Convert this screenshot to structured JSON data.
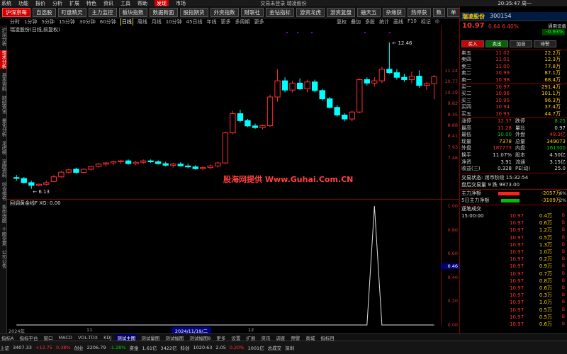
{
  "menu": {
    "items": [
      "系统",
      "功能",
      "报价",
      "分析",
      "扩展",
      "特色",
      "资讯",
      "工具",
      "帮助"
    ],
    "highlight": "发现",
    "highlight2": "市场",
    "title": "交易未登录   瑞凌股份",
    "time": "20:35:47",
    "week": "周一"
  },
  "toolbar": [
    "沪深京每",
    "自选股",
    "盯盘精灵",
    "主力监控",
    "板块指数",
    "数据新面",
    "股指期货",
    "外资指数",
    "财联社",
    "金钻指标",
    "游资龙虎",
    "游资复盘",
    "融天五",
    "杂缘获",
    "热停获",
    "数",
    "单",
    "全数单",
    "今号登录",
    "酷码杭",
    "数精"
  ],
  "toolbar_hl": [
    0
  ],
  "periods": [
    "分时",
    "1分钟",
    "5分钟",
    "15分钟",
    "30分钟",
    "60分钟",
    "日线",
    "周线",
    "月线",
    "10分钟",
    "45日线",
    "年线",
    "更多",
    "多周期",
    "更多"
  ],
  "period_active": "日线",
  "period_right": [
    "复权",
    "叠加",
    "多股",
    "统计",
    "画线",
    "F10",
    "标记",
    "◎"
  ],
  "sidebar": [
    "沪深分析",
    "技术分析",
    "基本资料",
    "财经资讯",
    "量化分析",
    "龙虎榜",
    "深度资料",
    "综合排名",
    "条件选股",
    "个股全景",
    "公司公告"
  ],
  "chart": {
    "title": "瑞凌股份(日线,前复权)",
    "price_labels": [
      "11.24",
      "10.77",
      "10.29",
      "9.82",
      "9.35",
      "8.88",
      "8.41",
      "7.93",
      "7.46"
    ],
    "high_mark": "12.46",
    "low_mark": "6.13"
  },
  "watermark": "股海网提供 Www.Guhai.Com.CN",
  "indicator": {
    "label": "回调黄金线F  XG: 0.00",
    "axis": [
      "1.00",
      "0.80",
      "0.60",
      "0.40",
      "0.20",
      "0.00"
    ],
    "current": "0.46"
  },
  "timebar": {
    "left": "2024年",
    "mark": "11",
    "highlight": "2024/11/19/二",
    "right": "12"
  },
  "bottomtabs": [
    "指标A",
    "指标平台",
    "窗口",
    "MACD",
    "VOL-TDX",
    "KDJ",
    "测试主图",
    "测试量图",
    "测试幅图",
    "测试幅图8",
    "更多",
    "设置",
    "扩展",
    "资讯",
    "调查",
    "预警",
    "商城",
    "指标目"
  ],
  "status": [
    "上证",
    "3407.33",
    "+12.75",
    "0.38%",
    "创业",
    "2206.79",
    "-1.28%",
    "资金",
    "1.61亿",
    "3422亿",
    "科创",
    "1020.63",
    "2.05",
    "0.20%",
    "1001亿",
    "总成交",
    "深圳"
  ],
  "right": {
    "name": "瑞凌股份",
    "code": "300154",
    "price": "10.97",
    "change": "0.64",
    "change_pct": "6.40%",
    "subtitle": "通用设备",
    "sub_value": "-0.93%",
    "buttons": [
      "买入",
      "卖出",
      "加自",
      "待警"
    ],
    "asks": [
      {
        "l": "卖五",
        "p": "11.02",
        "v": "22.2万"
      },
      {
        "l": "卖四",
        "p": "11.01",
        "v": "12.3万"
      },
      {
        "l": "卖三",
        "p": "11.00",
        "v": "77.8万"
      },
      {
        "l": "卖二",
        "p": "10.99",
        "v": "87.1万"
      },
      {
        "l": "卖一",
        "p": "10.98",
        "v": "68.4万"
      }
    ],
    "bids": [
      {
        "l": "买一",
        "p": "10.97",
        "v": "291.4万"
      },
      {
        "l": "买二",
        "p": "10.96",
        "v": "101.1万"
      },
      {
        "l": "买三",
        "p": "10.95",
        "v": "96.3万"
      },
      {
        "l": "买四",
        "p": "10.94",
        "v": "37.4万"
      },
      {
        "l": "买五",
        "p": "10.93",
        "v": "44.7万"
      }
    ],
    "stats": [
      [
        {
          "l": "涨停",
          "v": "12.37",
          "c": "red"
        },
        {
          "l": "跌停",
          "v": "8.25",
          "c": "grn"
        }
      ],
      [
        {
          "l": "最高",
          "v": "11.28",
          "c": "red"
        },
        {
          "l": "量比",
          "v": "0.97",
          "c": "wht"
        }
      ],
      [
        {
          "l": "最低",
          "v": "10.00",
          "c": "grn"
        },
        {
          "l": "外盘",
          "v": "49.3亿",
          "c": "red"
        }
      ],
      [
        {
          "l": "现量",
          "v": "7378",
          "c": "yel"
        },
        {
          "l": "总量",
          "v": "349073",
          "c": "yel"
        }
      ],
      [
        {
          "l": "外盘",
          "v": "187773",
          "c": "red"
        },
        {
          "l": "内盘",
          "v": "161300",
          "c": "grn"
        }
      ],
      [
        {
          "l": "换手",
          "v": "11.07%",
          "c": "wht"
        },
        {
          "l": "股本",
          "v": "4.50亿",
          "c": "wht"
        }
      ],
      [
        {
          "l": "净资",
          "v": "3.91",
          "c": "wht"
        },
        {
          "l": "流通",
          "v": "3.15亿",
          "c": "wht"
        }
      ],
      [
        {
          "l": "收益(三)",
          "v": "0.328",
          "c": "wht"
        },
        {
          "l": "PE(动)",
          "v": "25.0",
          "c": "wht"
        }
      ]
    ],
    "trade_state": "交易状态: 闭市阶段 15:32:54",
    "auction": "盘后交易量 9 跌 9873.00",
    "main_flow": {
      "l": "主力净额",
      "v": "-2057万",
      "pct": "6%"
    },
    "flow5": {
      "l": "5日主力净额",
      "v": "-3109万",
      "pct": "2%"
    },
    "ticks_title": "逐笔成交",
    "ticks": [
      {
        "t": "15:00:00",
        "p": "10.97",
        "v": "0.4万"
      },
      {
        "t": "",
        "p": "10.97",
        "v": "0.6万"
      },
      {
        "t": "",
        "p": "10.97",
        "v": "1.2万"
      },
      {
        "t": "",
        "p": "10.97",
        "v": "0.5万"
      },
      {
        "t": "",
        "p": "10.97",
        "v": "1.3万"
      },
      {
        "t": "",
        "p": "10.97",
        "v": "1.0万"
      },
      {
        "t": "",
        "p": "10.97",
        "v": "0.2万"
      },
      {
        "t": "",
        "p": "10.97",
        "v": "0.9万"
      },
      {
        "t": "",
        "p": "10.97",
        "v": "0.7万"
      },
      {
        "t": "",
        "p": "10.97",
        "v": "0.8万"
      },
      {
        "t": "",
        "p": "10.97",
        "v": "0.6万"
      },
      {
        "t": "",
        "p": "10.97",
        "v": "0.3万"
      },
      {
        "t": "",
        "p": "10.97",
        "v": "1.0万"
      },
      {
        "t": "",
        "p": "10.97",
        "v": "0.5万"
      },
      {
        "t": "",
        "p": "10.97",
        "v": "0.5万"
      },
      {
        "t": "",
        "p": "10.97",
        "v": "0.6万"
      }
    ]
  },
  "colors": {
    "up": "#ff3030",
    "down": "#00ffff",
    "grid": "#8a0000",
    "bg": "#000000"
  },
  "chart_data": {
    "type": "candlestick",
    "candles": [
      {
        "o": 6.62,
        "h": 6.73,
        "l": 6.48,
        "c": 6.58
      },
      {
        "o": 6.58,
        "h": 6.64,
        "l": 6.36,
        "c": 6.4
      },
      {
        "o": 6.4,
        "h": 6.48,
        "l": 6.13,
        "c": 6.28
      },
      {
        "o": 6.28,
        "h": 6.35,
        "l": 6.24,
        "c": 6.33
      },
      {
        "o": 6.33,
        "h": 6.48,
        "l": 6.28,
        "c": 6.4
      },
      {
        "o": 6.45,
        "h": 6.72,
        "l": 6.42,
        "c": 6.65
      },
      {
        "o": 6.65,
        "h": 6.9,
        "l": 6.6,
        "c": 6.85
      },
      {
        "o": 6.85,
        "h": 7.0,
        "l": 6.78,
        "c": 6.95
      },
      {
        "o": 6.98,
        "h": 7.05,
        "l": 6.8,
        "c": 6.84
      },
      {
        "o": 6.84,
        "h": 7.0,
        "l": 6.8,
        "c": 6.98
      },
      {
        "o": 6.98,
        "h": 7.12,
        "l": 6.92,
        "c": 7.1
      },
      {
        "o": 7.1,
        "h": 7.25,
        "l": 7.05,
        "c": 7.2
      },
      {
        "o": 7.2,
        "h": 7.3,
        "l": 7.1,
        "c": 7.25
      },
      {
        "o": 7.25,
        "h": 7.35,
        "l": 7.15,
        "c": 7.3
      },
      {
        "o": 7.3,
        "h": 7.38,
        "l": 7.2,
        "c": 7.34
      },
      {
        "o": 7.34,
        "h": 7.4,
        "l": 7.18,
        "c": 7.22
      },
      {
        "o": 7.22,
        "h": 7.33,
        "l": 7.15,
        "c": 7.28
      },
      {
        "o": 7.28,
        "h": 7.4,
        "l": 7.2,
        "c": 7.34
      },
      {
        "o": 7.34,
        "h": 7.4,
        "l": 7.25,
        "c": 7.3
      },
      {
        "o": 7.3,
        "h": 7.36,
        "l": 7.18,
        "c": 7.22
      },
      {
        "o": 7.22,
        "h": 7.3,
        "l": 7.1,
        "c": 7.15
      },
      {
        "o": 7.15,
        "h": 7.26,
        "l": 7.05,
        "c": 7.2
      },
      {
        "o": 7.2,
        "h": 7.28,
        "l": 7.1,
        "c": 7.12
      },
      {
        "o": 7.12,
        "h": 7.22,
        "l": 7.02,
        "c": 7.08
      },
      {
        "o": 7.08,
        "h": 7.15,
        "l": 6.96,
        "c": 7.0
      },
      {
        "o": 7.0,
        "h": 7.1,
        "l": 6.92,
        "c": 7.05
      },
      {
        "o": 7.05,
        "h": 7.18,
        "l": 6.98,
        "c": 7.12
      },
      {
        "o": 7.12,
        "h": 7.3,
        "l": 7.05,
        "c": 7.25
      },
      {
        "o": 7.25,
        "h": 8.6,
        "l": 7.2,
        "c": 8.55
      },
      {
        "o": 8.55,
        "h": 9.5,
        "l": 8.5,
        "c": 9.38
      },
      {
        "o": 9.38,
        "h": 9.55,
        "l": 9.0,
        "c": 9.08
      },
      {
        "o": 9.08,
        "h": 9.15,
        "l": 8.8,
        "c": 8.85
      },
      {
        "o": 8.85,
        "h": 8.95,
        "l": 8.72,
        "c": 8.78
      },
      {
        "o": 8.78,
        "h": 8.9,
        "l": 8.7,
        "c": 8.86
      },
      {
        "o": 8.86,
        "h": 10.2,
        "l": 8.8,
        "c": 10.1
      },
      {
        "o": 10.1,
        "h": 11.3,
        "l": 9.9,
        "c": 10.8
      },
      {
        "o": 10.8,
        "h": 10.95,
        "l": 10.3,
        "c": 10.4
      },
      {
        "o": 10.4,
        "h": 10.8,
        "l": 10.3,
        "c": 10.7
      },
      {
        "o": 10.7,
        "h": 10.9,
        "l": 10.4,
        "c": 10.45
      },
      {
        "o": 10.45,
        "h": 10.85,
        "l": 10.3,
        "c": 10.75
      },
      {
        "o": 10.75,
        "h": 10.85,
        "l": 10.3,
        "c": 10.38
      },
      {
        "o": 10.38,
        "h": 10.45,
        "l": 9.95,
        "c": 10.02
      },
      {
        "o": 10.02,
        "h": 10.1,
        "l": 9.6,
        "c": 9.65
      },
      {
        "o": 9.65,
        "h": 9.75,
        "l": 9.25,
        "c": 9.32
      },
      {
        "o": 9.32,
        "h": 9.4,
        "l": 9.05,
        "c": 9.15
      },
      {
        "o": 9.15,
        "h": 9.5,
        "l": 9.05,
        "c": 9.45
      },
      {
        "o": 9.45,
        "h": 10.9,
        "l": 9.4,
        "c": 10.85
      },
      {
        "o": 10.85,
        "h": 10.95,
        "l": 10.6,
        "c": 10.7
      },
      {
        "o": 10.7,
        "h": 10.95,
        "l": 10.55,
        "c": 10.8
      },
      {
        "o": 10.8,
        "h": 11.4,
        "l": 10.7,
        "c": 11.3
      },
      {
        "o": 11.3,
        "h": 12.46,
        "l": 11.1,
        "c": 11.15
      },
      {
        "o": 11.15,
        "h": 11.3,
        "l": 10.85,
        "c": 10.95
      },
      {
        "o": 10.95,
        "h": 11.1,
        "l": 10.75,
        "c": 10.85
      },
      {
        "o": 10.85,
        "h": 11.2,
        "l": 10.7,
        "c": 11.0
      },
      {
        "o": 11.0,
        "h": 11.25,
        "l": 10.5,
        "c": 10.6
      },
      {
        "o": 10.6,
        "h": 10.75,
        "l": 10.4,
        "c": 10.68
      },
      {
        "o": 10.68,
        "h": 11.05,
        "l": 10.0,
        "c": 10.97
      }
    ],
    "ylim": [
      6.0,
      12.7
    ],
    "indicator": {
      "name": "XG",
      "values": [
        0,
        0,
        0,
        0,
        0,
        0,
        0,
        0,
        0,
        0,
        0,
        0,
        0,
        0,
        0,
        0,
        0,
        0,
        0,
        0,
        0,
        0,
        0,
        0,
        0,
        0,
        0,
        0,
        0,
        0,
        0,
        0,
        0,
        0,
        0,
        0,
        0,
        0,
        0,
        0,
        0,
        0,
        0,
        0,
        0,
        0,
        0,
        0,
        0,
        0,
        0,
        0,
        0,
        0,
        0,
        0,
        0
      ],
      "spike_index": 48,
      "ylim": [
        0,
        1
      ]
    }
  }
}
